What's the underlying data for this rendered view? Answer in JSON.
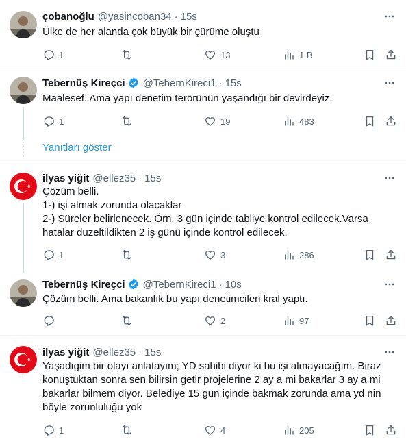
{
  "tweets": [
    {
      "name": "çobanoğlu",
      "handle": "@yasincoban34",
      "time": "15s",
      "verified": false,
      "text": "Ülke de her alanda çok büyük bir çürüme oluştu",
      "avatar": "photo-avatar",
      "stats": {
        "replies": "1",
        "retweets": "",
        "likes": "13",
        "views": "1 B"
      }
    },
    {
      "name": "Tebernüş Kireçci",
      "handle": "@TebernKireci1",
      "time": "15s",
      "verified": true,
      "text": "Maalesef. Ama yapı denetim terörünün yaşandığı bir devirdeyiz.",
      "avatar": "photo-avatar",
      "stats": {
        "replies": "1",
        "retweets": "",
        "likes": "19",
        "views": "483"
      }
    },
    {
      "name": "ilyas yiğit",
      "handle": "@ellez35",
      "time": "15s",
      "verified": false,
      "text": "Çözüm belli.\n1-) işi almak zorunda olacaklar\n2-) Süreler belirlenecek. Örn. 3 gün içinde tabliye kontrol edilecek.Varsa hatalar duzeltildikten 2 iş günü içinde kontrol edilecek.",
      "avatar": "turkish-flag-avatar",
      "stats": {
        "replies": "1",
        "retweets": "",
        "likes": "3",
        "views": "286"
      }
    },
    {
      "name": "Tebernüş Kireçci",
      "handle": "@TebernKireci1",
      "time": "10s",
      "verified": true,
      "text": "Çözüm belli. Ama bakanlık bu yapı denetimcileri kral yaptı.",
      "avatar": "photo-avatar",
      "stats": {
        "replies": "",
        "retweets": "",
        "likes": "2",
        "views": "97"
      }
    },
    {
      "name": "ilyas yiğit",
      "handle": "@ellez35",
      "time": "15s",
      "verified": false,
      "text": "Yaşadıgim bir olayı anlatayım; YD sahibi diyor ki bu işi almayacağım. Biraz konuştuktan sonra sen bilirsin getir projelerine 2 ay a mi bakarlar 3 ay a mi bakarlar bilmem diyor. Belediye 15 gün içinde bakmak zorunda ama yd nin böyle zorunluluğu yok",
      "avatar": "turkish-flag-avatar",
      "stats": {
        "replies": "1",
        "retweets": "",
        "likes": "4",
        "views": "205"
      }
    }
  ],
  "show_replies_label": "Yanıtları göster",
  "separator": "·",
  "colors": {
    "accent": "#1d9bf0",
    "muted": "#536471",
    "text": "#0f1419",
    "flag_red": "#e30a17"
  },
  "icons": [
    "reply-icon",
    "retweet-icon",
    "like-icon",
    "views-icon",
    "bookmark-icon",
    "share-icon",
    "more-icon",
    "verified-badge-icon"
  ]
}
